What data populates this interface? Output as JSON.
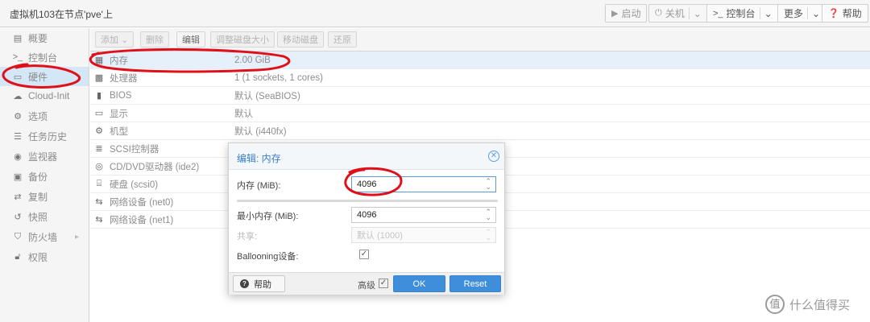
{
  "window": {
    "title": "虚拟机103在节点'pve'上"
  },
  "header_buttons": {
    "start": "启动",
    "shutdown": "关机",
    "console": "控制台",
    "more": "更多",
    "help": "帮助"
  },
  "nav": [
    {
      "label": "概要",
      "icon": "book-icon"
    },
    {
      "label": "控制台",
      "icon": "terminal-icon"
    },
    {
      "label": "硬件",
      "icon": "monitor-icon",
      "selected": true
    },
    {
      "label": "Cloud-Init",
      "icon": "cloud-icon"
    },
    {
      "label": "选项",
      "icon": "gear-icon"
    },
    {
      "label": "任务历史",
      "icon": "list-icon"
    },
    {
      "label": "监视器",
      "icon": "eye-icon"
    },
    {
      "label": "备份",
      "icon": "floppy-icon"
    },
    {
      "label": "复制",
      "icon": "retweet-icon"
    },
    {
      "label": "快照",
      "icon": "history-icon"
    },
    {
      "label": "防火墙",
      "icon": "shield-icon"
    },
    {
      "label": "权限",
      "icon": "unlock-icon"
    }
  ],
  "toolbar": [
    "添加",
    "删除",
    "编辑",
    "调整磁盘大小",
    "移动磁盘",
    "还原"
  ],
  "hardware": [
    {
      "key": "内存",
      "value": "2.00 GiB",
      "icon": "memory-icon",
      "selected": true
    },
    {
      "key": "处理器",
      "value": "1 (1 sockets, 1 cores)",
      "icon": "cpu-icon"
    },
    {
      "key": "BIOS",
      "value": "默认 (SeaBIOS)",
      "icon": "microchip-icon"
    },
    {
      "key": "显示",
      "value": "默认",
      "icon": "desktop-icon"
    },
    {
      "key": "机型",
      "value": "默认 (i440fx)",
      "icon": "cogs-icon"
    },
    {
      "key": "SCSI控制器",
      "value": "",
      "icon": "database-icon"
    },
    {
      "key": "CD/DVD驱动器 (ide2)",
      "value": "",
      "icon": "cdrom-icon"
    },
    {
      "key": "硬盘 (scsi0)",
      "value": "",
      "icon": "hdd-icon"
    },
    {
      "key": "网络设备 (net0)",
      "value": "",
      "icon": "exchange-icon"
    },
    {
      "key": "网络设备 (net1)",
      "value": "",
      "icon": "exchange-icon"
    }
  ],
  "dialog": {
    "title": "编辑: 内存",
    "fields": {
      "memory_label": "内存 (MiB):",
      "memory_value": "4096",
      "min_memory_label": "最小内存 (MiB):",
      "min_memory_value": "4096",
      "shares_label": "共享:",
      "shares_placeholder": "默认 (1000)",
      "ballooning_label": "Ballooning设备:"
    },
    "help_button": "帮助",
    "advanced_label": "高级",
    "ok_button": "OK",
    "reset_button": "Reset"
  },
  "watermark": {
    "logo": "值",
    "text": "什么值得买"
  },
  "colors": {
    "accent": "#3f8edc",
    "annotation": "#e0101a",
    "selection": "#d3e7f7"
  }
}
